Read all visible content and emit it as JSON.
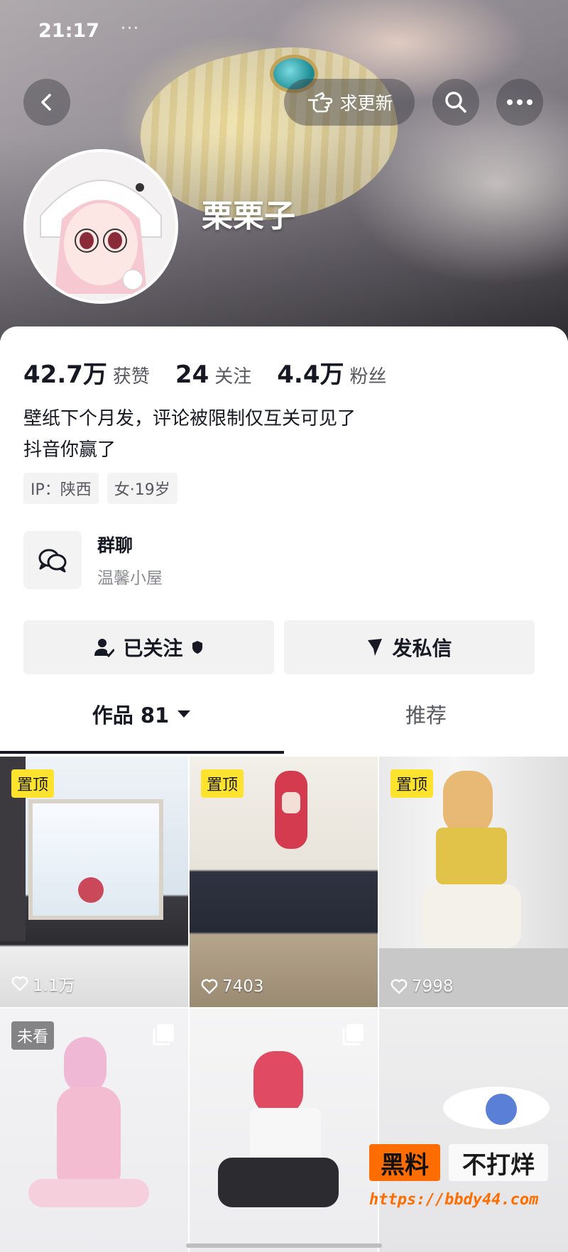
{
  "status_bar": {
    "time": "21:17",
    "dots": "···"
  },
  "header": {
    "request_update_label": "求更新",
    "nickname": "栗栗子"
  },
  "stats": [
    {
      "value": "42.7万",
      "label": "获赞"
    },
    {
      "value": "24",
      "label": "关注"
    },
    {
      "value": "4.4万",
      "label": "粉丝"
    }
  ],
  "bio": {
    "line1": "壁纸下个月发，评论被限制仅互关可见了",
    "line2": "抖音你赢了"
  },
  "tags": [
    "IP：陕西",
    "女·19岁"
  ],
  "group_chat": {
    "title": "群聊",
    "subtitle": "温馨小屋"
  },
  "actions": {
    "followed_label": "已关注",
    "message_label": "发私信"
  },
  "tabs": {
    "works_label": "作品 81",
    "recommend_label": "推荐"
  },
  "grid": [
    {
      "badge": "置顶",
      "likes": "1.1万"
    },
    {
      "badge": "置顶",
      "likes": "7403"
    },
    {
      "badge": "置顶",
      "likes": "7998"
    },
    {
      "badge": "未看",
      "likes": ""
    },
    {
      "badge": "",
      "likes": ""
    },
    {
      "badge": "",
      "likes": ""
    }
  ],
  "watermark": {
    "part1": "黑料",
    "part2": "不打烊",
    "url": "https://bbdy44.com"
  },
  "colors": {
    "pin_badge": "#fde22e",
    "watermark_orange": "#ff6d00",
    "text_primary": "#161823"
  }
}
